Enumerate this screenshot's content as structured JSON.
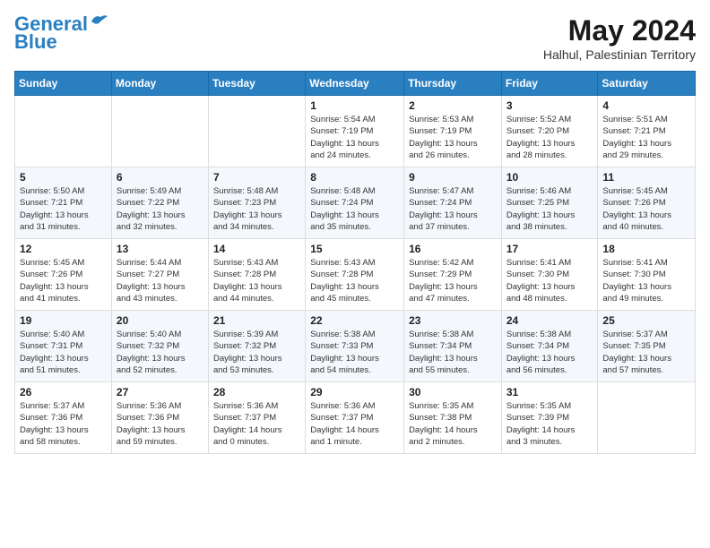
{
  "header": {
    "logo_line1": "General",
    "logo_line2": "Blue",
    "month_title": "May 2024",
    "subtitle": "Halhul, Palestinian Territory"
  },
  "columns": [
    "Sunday",
    "Monday",
    "Tuesday",
    "Wednesday",
    "Thursday",
    "Friday",
    "Saturday"
  ],
  "weeks": [
    [
      {
        "day": "",
        "info": ""
      },
      {
        "day": "",
        "info": ""
      },
      {
        "day": "",
        "info": ""
      },
      {
        "day": "1",
        "info": "Sunrise: 5:54 AM\nSunset: 7:19 PM\nDaylight: 13 hours\nand 24 minutes."
      },
      {
        "day": "2",
        "info": "Sunrise: 5:53 AM\nSunset: 7:19 PM\nDaylight: 13 hours\nand 26 minutes."
      },
      {
        "day": "3",
        "info": "Sunrise: 5:52 AM\nSunset: 7:20 PM\nDaylight: 13 hours\nand 28 minutes."
      },
      {
        "day": "4",
        "info": "Sunrise: 5:51 AM\nSunset: 7:21 PM\nDaylight: 13 hours\nand 29 minutes."
      }
    ],
    [
      {
        "day": "5",
        "info": "Sunrise: 5:50 AM\nSunset: 7:21 PM\nDaylight: 13 hours\nand 31 minutes."
      },
      {
        "day": "6",
        "info": "Sunrise: 5:49 AM\nSunset: 7:22 PM\nDaylight: 13 hours\nand 32 minutes."
      },
      {
        "day": "7",
        "info": "Sunrise: 5:48 AM\nSunset: 7:23 PM\nDaylight: 13 hours\nand 34 minutes."
      },
      {
        "day": "8",
        "info": "Sunrise: 5:48 AM\nSunset: 7:24 PM\nDaylight: 13 hours\nand 35 minutes."
      },
      {
        "day": "9",
        "info": "Sunrise: 5:47 AM\nSunset: 7:24 PM\nDaylight: 13 hours\nand 37 minutes."
      },
      {
        "day": "10",
        "info": "Sunrise: 5:46 AM\nSunset: 7:25 PM\nDaylight: 13 hours\nand 38 minutes."
      },
      {
        "day": "11",
        "info": "Sunrise: 5:45 AM\nSunset: 7:26 PM\nDaylight: 13 hours\nand 40 minutes."
      }
    ],
    [
      {
        "day": "12",
        "info": "Sunrise: 5:45 AM\nSunset: 7:26 PM\nDaylight: 13 hours\nand 41 minutes."
      },
      {
        "day": "13",
        "info": "Sunrise: 5:44 AM\nSunset: 7:27 PM\nDaylight: 13 hours\nand 43 minutes."
      },
      {
        "day": "14",
        "info": "Sunrise: 5:43 AM\nSunset: 7:28 PM\nDaylight: 13 hours\nand 44 minutes."
      },
      {
        "day": "15",
        "info": "Sunrise: 5:43 AM\nSunset: 7:28 PM\nDaylight: 13 hours\nand 45 minutes."
      },
      {
        "day": "16",
        "info": "Sunrise: 5:42 AM\nSunset: 7:29 PM\nDaylight: 13 hours\nand 47 minutes."
      },
      {
        "day": "17",
        "info": "Sunrise: 5:41 AM\nSunset: 7:30 PM\nDaylight: 13 hours\nand 48 minutes."
      },
      {
        "day": "18",
        "info": "Sunrise: 5:41 AM\nSunset: 7:30 PM\nDaylight: 13 hours\nand 49 minutes."
      }
    ],
    [
      {
        "day": "19",
        "info": "Sunrise: 5:40 AM\nSunset: 7:31 PM\nDaylight: 13 hours\nand 51 minutes."
      },
      {
        "day": "20",
        "info": "Sunrise: 5:40 AM\nSunset: 7:32 PM\nDaylight: 13 hours\nand 52 minutes."
      },
      {
        "day": "21",
        "info": "Sunrise: 5:39 AM\nSunset: 7:32 PM\nDaylight: 13 hours\nand 53 minutes."
      },
      {
        "day": "22",
        "info": "Sunrise: 5:38 AM\nSunset: 7:33 PM\nDaylight: 13 hours\nand 54 minutes."
      },
      {
        "day": "23",
        "info": "Sunrise: 5:38 AM\nSunset: 7:34 PM\nDaylight: 13 hours\nand 55 minutes."
      },
      {
        "day": "24",
        "info": "Sunrise: 5:38 AM\nSunset: 7:34 PM\nDaylight: 13 hours\nand 56 minutes."
      },
      {
        "day": "25",
        "info": "Sunrise: 5:37 AM\nSunset: 7:35 PM\nDaylight: 13 hours\nand 57 minutes."
      }
    ],
    [
      {
        "day": "26",
        "info": "Sunrise: 5:37 AM\nSunset: 7:36 PM\nDaylight: 13 hours\nand 58 minutes."
      },
      {
        "day": "27",
        "info": "Sunrise: 5:36 AM\nSunset: 7:36 PM\nDaylight: 13 hours\nand 59 minutes."
      },
      {
        "day": "28",
        "info": "Sunrise: 5:36 AM\nSunset: 7:37 PM\nDaylight: 14 hours\nand 0 minutes."
      },
      {
        "day": "29",
        "info": "Sunrise: 5:36 AM\nSunset: 7:37 PM\nDaylight: 14 hours\nand 1 minute."
      },
      {
        "day": "30",
        "info": "Sunrise: 5:35 AM\nSunset: 7:38 PM\nDaylight: 14 hours\nand 2 minutes."
      },
      {
        "day": "31",
        "info": "Sunrise: 5:35 AM\nSunset: 7:39 PM\nDaylight: 14 hours\nand 3 minutes."
      },
      {
        "day": "",
        "info": ""
      }
    ]
  ]
}
